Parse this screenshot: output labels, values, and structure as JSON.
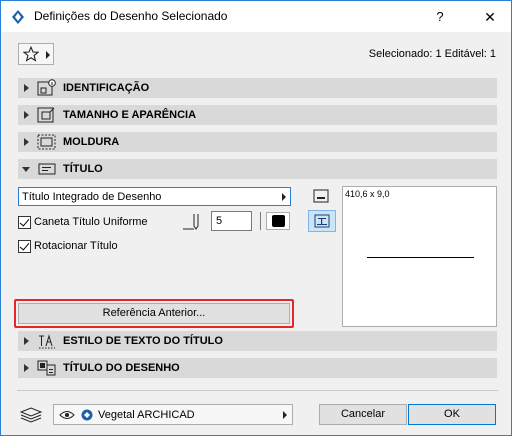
{
  "window": {
    "title": "Definições do Desenho Selecionado",
    "help": "?",
    "close": "✕"
  },
  "header": {
    "selected_info": "Selecionado: 1 Editável: 1"
  },
  "sections": {
    "identificacao": "IDENTIFICAÇÃO",
    "tamanho": "TAMANHO E APARÊNCIA",
    "moldura": "MOLDURA",
    "titulo": "TÍTULO",
    "estilo": "ESTILO DE TEXTO DO TÍTULO",
    "titulo_desenho": "TÍTULO DO DESENHO"
  },
  "title_panel": {
    "type_value": "Título Integrado de Desenho",
    "uniform_pen_label": "Caneta Título Uniforme",
    "uniform_pen_checked": true,
    "pen_value": "5",
    "rotate_label": "Rotacionar Título",
    "rotate_checked": true,
    "preview_size": "410,6 x 9,0",
    "ref_button": "Referência Anterior..."
  },
  "footer": {
    "layer_name": "Vegetal ARCHICAD",
    "cancel": "Cancelar",
    "ok": "OK"
  },
  "colors": {
    "accent": "#2b7fd6",
    "highlight": "#e8262a",
    "section_bg": "#d9d9d9"
  }
}
